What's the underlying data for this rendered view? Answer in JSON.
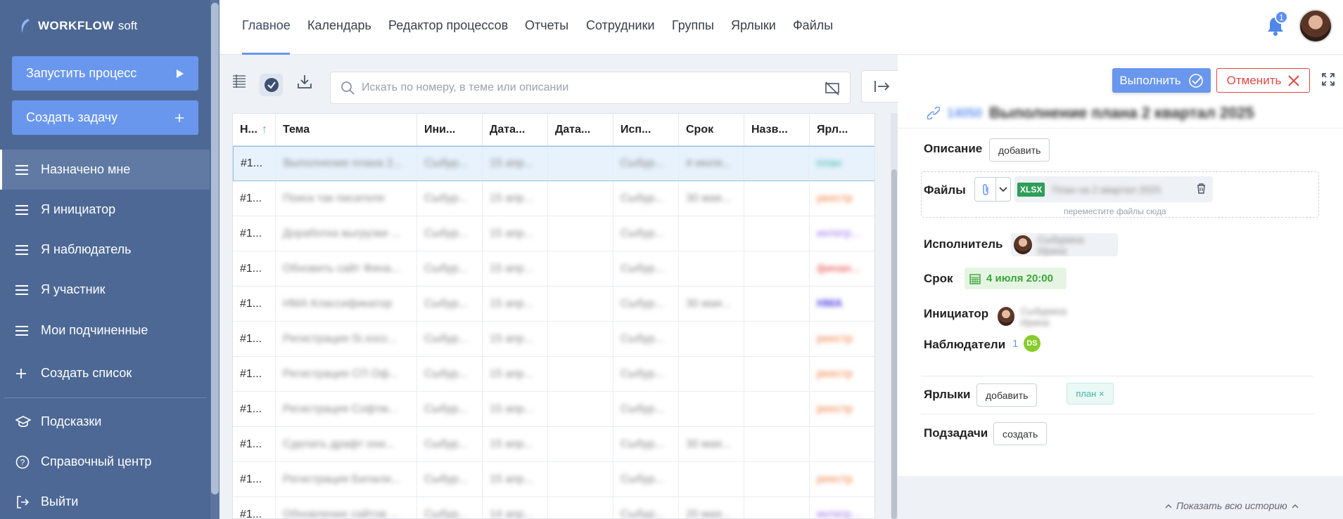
{
  "app": {
    "brand": "WORKFLOW",
    "brand_sub": "soft"
  },
  "sidebar": {
    "run_process": "Запустить процесс",
    "create_task": "Создать задачу",
    "items": [
      {
        "label": "Назначено мне",
        "icon": "hamburger-icon"
      },
      {
        "label": "Я инициатор",
        "icon": "hamburger-icon"
      },
      {
        "label": "Я наблюдатель",
        "icon": "hamburger-icon"
      },
      {
        "label": "Я участник",
        "icon": "hamburger-icon"
      },
      {
        "label": "Мои подчиненные",
        "icon": "hamburger-icon"
      },
      {
        "label": "Создать список",
        "icon": "plus-icon"
      }
    ],
    "bottom": [
      {
        "label": "Подсказки",
        "icon": "graduation-cap-icon"
      },
      {
        "label": "Справочный центр",
        "icon": "help-circle-icon"
      },
      {
        "label": "Выйти",
        "icon": "logout-icon"
      }
    ]
  },
  "topnav": {
    "tabs": [
      "Главное",
      "Календарь",
      "Редактор процессов",
      "Отчеты",
      "Сотрудники",
      "Группы",
      "Ярлыки",
      "Файлы"
    ],
    "active_tab": "Главное",
    "notifications": "1"
  },
  "toolbar": {
    "search_placeholder": "Искать по номеру, в теме или описании"
  },
  "table": {
    "columns": [
      "Н...",
      "Тема",
      "Ини...",
      "Дата...",
      "Дата...",
      "Исп...",
      "Срок",
      "Назв...",
      "Ярл..."
    ],
    "sort_indicator": "↑",
    "rows": [
      {
        "num": "#1...",
        "topic": "Выполнение плана 2...",
        "init": "Сыбур...",
        "date1": "15 апр...",
        "date2": "",
        "exec": "Сыбур...",
        "due": "4 июля...",
        "name": "",
        "label": "план",
        "label_color": "teal",
        "selected": true
      },
      {
        "num": "#1...",
        "topic": "Поиск так писателя",
        "init": "Сыбур...",
        "date1": "15 апр...",
        "date2": "",
        "exec": "Сыбур...",
        "due": "30 мая...",
        "name": "",
        "label": "реестр",
        "label_color": "orange"
      },
      {
        "num": "#1...",
        "topic": "Доработка выгрузки ...",
        "init": "Сыбур...",
        "date1": "15 апр...",
        "date2": "",
        "exec": "Сыбур...",
        "due": "",
        "name": "",
        "label": "интегр...",
        "label_color": "purple"
      },
      {
        "num": "#1...",
        "topic": "Обновить сайт Фина...",
        "init": "Сыбур...",
        "date1": "15 апр...",
        "date2": "",
        "exec": "Сыбур...",
        "due": "",
        "name": "",
        "label": "финан...",
        "label_color": "red"
      },
      {
        "num": "#1...",
        "topic": "НМА Классификатор",
        "init": "Сыбур...",
        "date1": "15 апр...",
        "date2": "",
        "exec": "Сыбур...",
        "due": "30 мая...",
        "name": "",
        "label": "НМА",
        "label_color": "violet"
      },
      {
        "num": "#1...",
        "topic": "Регистрация Si.хосс...",
        "init": "Сыбур...",
        "date1": "15 апр...",
        "date2": "",
        "exec": "Сыбур...",
        "due": "",
        "name": "",
        "label": "реестр",
        "label_color": "orange"
      },
      {
        "num": "#1...",
        "topic": "Регистрация СП Оф...",
        "init": "Сыбур...",
        "date1": "15 апр...",
        "date2": "",
        "exec": "Сыбур...",
        "due": "",
        "name": "",
        "label": "реестр",
        "label_color": "orange"
      },
      {
        "num": "#1...",
        "topic": "Регистрация Софтм...",
        "init": "Сыбур...",
        "date1": "15 апр...",
        "date2": "",
        "exec": "Сыбур...",
        "due": "",
        "name": "",
        "label": "реестр",
        "label_color": "orange"
      },
      {
        "num": "#1...",
        "topic": "Сделать драфт они...",
        "init": "Сыбур...",
        "date1": "15 апр...",
        "date2": "",
        "exec": "Сыбур...",
        "due": "30 мая...",
        "name": "",
        "label": "",
        "label_color": "orange"
      },
      {
        "num": "#1...",
        "topic": "Регистрация Билали...",
        "init": "Сыбур...",
        "date1": "15 апр...",
        "date2": "",
        "exec": "Сыбур...",
        "due": "",
        "name": "",
        "label": "реестр",
        "label_color": "orange"
      },
      {
        "num": "#1...",
        "topic": "Обновление сайтов ...",
        "init": "Сыбур...",
        "date1": "14 апр...",
        "date2": "",
        "exec": "Сыбур...",
        "due": "20 мая...",
        "name": "",
        "label": "интегр...",
        "label_color": "purple"
      }
    ]
  },
  "detail": {
    "do_label": "Выполнить",
    "cancel_label": "Отменить",
    "task_id": "14050",
    "task_title": "Выполнение плана 2 квартал 2025",
    "description_label": "Описание",
    "add_label": "добавить",
    "files_label": "Файлы",
    "file_ext": "XLSX",
    "file_name": "План на 2 квартал 2025",
    "drop_hint": "переместите файлы сюда",
    "assignee_label": "Исполнитель",
    "assignee_name": "Сыбурина Ирина",
    "due_label": "Срок",
    "due_value": "4 июля 20:00",
    "initiator_label": "Инициатор",
    "initiator_name": "Сыбурина Ирина",
    "observers_label": "Наблюдатели",
    "observers_count": "1",
    "observer_initials": "DS",
    "tags_label": "Ярлыки",
    "tags_add": "добавить",
    "tag_chip": "план ×",
    "subtasks_label": "Подзадачи",
    "subtasks_create": "создать",
    "history_link": "Показать всю историю"
  },
  "colors": {
    "sidebar_bg": "#4d6894",
    "accent": "#6a97ee",
    "danger": "#e04848",
    "success": "#3aa53a",
    "excel": "#2e9e58"
  }
}
